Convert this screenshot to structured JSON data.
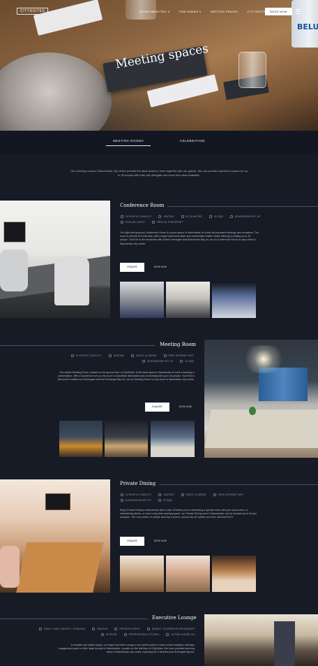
{
  "header": {
    "logo": "CITYSUITES",
    "nav": [
      "ROOM AMENITIES ∨",
      "FINE DINING ∨",
      "MEETING SPACES",
      "CITY DESTINATIONS"
    ],
    "book_now": "BOOK NOW"
  },
  "hero": {
    "title": "Meeting spaces",
    "bottle_text": "BELU"
  },
  "tabs": [
    "MEETING ROOMS",
    "CELEBRATION"
  ],
  "intro": "Our meeting rooms in Manchester city centre provide the ideal space to meet together with our guests. We can provide boardroom space for up to 30 people with both day delegate and event hire rates available.",
  "rooms": [
    {
      "name": "Conference Room",
      "features": [
        "30 PEOPLE CAPACITY",
        "SEATING",
        "82 SQ METRE",
        "25 SQM",
        "BOARDROOM SET UP",
        "DAIS MIC AUDIO",
        "FREE WI-FI/INTERNET"
      ],
      "description": "Our light and spacious Conference Room is a good space in Manchester for those all-important meetings and occasions. The room is cleverly fit in this time, with a large boardroom table and comfortable leather chairs allowing a seating up to 30 people. You'll be in the remainder with Smart Greengate and Boardroom Bay on, as our Conference Room is easy close to Manchester city centre.",
      "enquire": "ENQUIRE",
      "book": "BOOK NOW"
    },
    {
      "name": "Meeting Room",
      "features": [
        "16 PEOPLE CAPACITY",
        "SEATING",
        "SEATS 16 ADDED",
        "FREE INTERNET WIFI",
        "BOARDROOM SET UP",
        "25 SQM"
      ],
      "description": "Our stylish Meeting Room, located on the ground floor of CitySuites, is the ideal space in Manchester to hold a meeting or presentation. With a boardroom set up, this room is beautifully illuminated and comfortably sits up to 16 people. You'll find a flat-screen media from Greengate and the Exchange Bay too, as our Meeting Room is very close to Manchester city centre.",
      "enquire": "ENQUIRE",
      "book": "BOOK NOW"
    },
    {
      "name": "Private Dining",
      "features": [
        "24 PEOPLE CAPACITY",
        "SEATING",
        "SEATS 16 ADDED",
        "FREE INTERNET WIFI",
        "BOARDROOM SET UP",
        "25 SQM"
      ],
      "description": "Enjoy Private Dining in Manchester with a view. Whether you're celebrating a special event with your loved ones, or entertaining clients, or need a day-time meeting space, our Private Dining room in Manchester can be dressed up to fit your occasion. The room seats 12 people and has a screen, should any AV system and free ultra-fast Wi-Fi.",
      "enquire": "ENQUIRE",
      "book": "BOOK NOW"
    },
    {
      "name": "Executive Lounge",
      "features": [
        "SMALL TABLE SEATED / STANDING",
        "SEATING",
        "PRIVATE EVENTS",
        "BASKET, CLASSROOM OR BANQUET",
        "IN-ROOM",
        "PROFESSIONAL KITCHEN",
        "LISTING HOURS 24H"
      ],
      "description": "A versatile and stylish space, our large Executive Lounge is the perfect place to host a small reception, birthday, engagement party or other large function in Manchester. Located on the first floor of CitySuites, the room provides stunning views of Manchester city centre, including the Cathedral and Greengate flyover."
    }
  ]
}
